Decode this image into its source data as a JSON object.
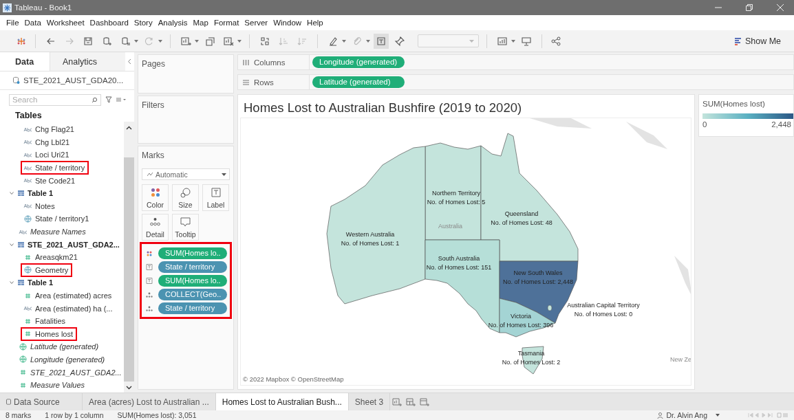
{
  "window": {
    "title": "Tableau - Book1"
  },
  "menu": [
    "File",
    "Data",
    "Worksheet",
    "Dashboard",
    "Story",
    "Analysis",
    "Map",
    "Format",
    "Server",
    "Window",
    "Help"
  ],
  "toolbar": {
    "show_me": "Show Me"
  },
  "data_pane": {
    "tabs": [
      {
        "label": "Data",
        "selected": true
      },
      {
        "label": "Analytics",
        "selected": false
      }
    ],
    "datasource": "STE_2021_AUST_GDA20...",
    "search": {
      "placeholder": "Search"
    },
    "tables_heading": "Tables",
    "partial_fields": [
      {
        "name": "Chg Flag21",
        "kind": "string",
        "italic": false,
        "highlighted": false
      },
      {
        "name": "Chg Lbl21",
        "kind": "string",
        "italic": false,
        "highlighted": false
      },
      {
        "name": "Loci Uri21",
        "kind": "string",
        "italic": false,
        "highlighted": false
      },
      {
        "name": "State / territory",
        "kind": "string",
        "italic": false,
        "highlighted": true
      },
      {
        "name": "Ste Code21",
        "kind": "string",
        "italic": false,
        "highlighted": false
      }
    ],
    "fields": [
      {
        "kind": "table",
        "name": "Table 1",
        "expanded": true,
        "children": [
          {
            "name": "Notes",
            "kind": "string",
            "italic": false,
            "highlighted": false
          },
          {
            "name": "State / territory1",
            "kind": "geo",
            "italic": false,
            "highlighted": false
          }
        ]
      },
      {
        "kind": "string",
        "name": "Measure Names",
        "italic": true,
        "highlighted": false
      },
      {
        "kind": "table",
        "name": "STE_2021_AUST_GDA2...",
        "expanded": true,
        "children": [
          {
            "name": "Areasqkm21",
            "kind": "number",
            "italic": false,
            "highlighted": false
          },
          {
            "name": "Geometry",
            "kind": "geo",
            "italic": false,
            "highlighted": true
          }
        ]
      },
      {
        "kind": "table",
        "name": "Table 1",
        "expanded": true,
        "children": [
          {
            "name": "Area (estimated) acres",
            "kind": "number",
            "italic": false,
            "highlighted": false
          },
          {
            "name": "Area (estimated) ha (...",
            "kind": "string",
            "italic": false,
            "highlighted": false
          },
          {
            "name": "Fatalities",
            "kind": "number",
            "italic": false,
            "highlighted": false
          },
          {
            "name": "Homes lost",
            "kind": "number",
            "italic": false,
            "highlighted": true
          }
        ]
      },
      {
        "kind": "generated",
        "name": "Latitude (generated)",
        "italic": true,
        "highlighted": false
      },
      {
        "kind": "generated",
        "name": "Longitude (generated)",
        "italic": true,
        "highlighted": false
      },
      {
        "kind": "number",
        "name": "STE_2021_AUST_GDA2...",
        "italic": true,
        "highlighted": false
      },
      {
        "kind": "number",
        "name": "Measure Values",
        "italic": true,
        "highlighted": false
      }
    ]
  },
  "pages": {
    "title": "Pages"
  },
  "filters": {
    "title": "Filters"
  },
  "marks": {
    "title": "Marks",
    "mark_type": "Automatic",
    "buttons": [
      {
        "label": "Color",
        "kind": "color"
      },
      {
        "label": "Size",
        "kind": "size"
      },
      {
        "label": "Label",
        "kind": "label"
      },
      {
        "label": "Detail",
        "kind": "detail"
      },
      {
        "label": "Tooltip",
        "kind": "tooltip"
      }
    ],
    "pills_highlighted": true,
    "pills": [
      {
        "label": "SUM(Homes lo..",
        "kind": "color",
        "color": "#1fae78"
      },
      {
        "label": "State / territory",
        "kind": "label",
        "color": "#4b93b1"
      },
      {
        "label": "SUM(Homes lo..",
        "kind": "label",
        "color": "#1fae78"
      },
      {
        "label": "COLLECT(Geo..",
        "kind": "detail",
        "color": "#4b93b1"
      },
      {
        "label": "State / territory",
        "kind": "detail",
        "color": "#4b93b1"
      }
    ]
  },
  "shelves": [
    {
      "label": "Columns",
      "kind": "columns",
      "pills": [
        {
          "label": "Longitude (generated)",
          "color": "#1fae78"
        }
      ]
    },
    {
      "label": "Rows",
      "kind": "rows",
      "pills": [
        {
          "label": "Latitude (generated)",
          "color": "#1fae78"
        }
      ]
    }
  ],
  "view": {
    "title": "Homes Lost to Australian Bushfire (2019 to 2020)",
    "regions": [
      {
        "name": "Northern Territory",
        "label": "No. of Homes Lost: 5",
        "color": "#c4e4dc"
      },
      {
        "name": "Queensland",
        "label": "No. of Homes Lost: 48",
        "color": "#c4e4dc"
      },
      {
        "name": "Western Australia",
        "label": "No. of Homes Lost: 1",
        "color": "#c4e4dc"
      },
      {
        "name": "South Australia",
        "label": "No. of Homes Lost: 151",
        "color": "#b6dfd8"
      },
      {
        "name": "New South Wales",
        "label": "No. of Homes Lost: 2,448",
        "color": "#4e7199"
      },
      {
        "name": "Australian Capital Territory",
        "label": "No. of Homes Lost: 0",
        "color": "#c4e4dc"
      },
      {
        "name": "Victoria",
        "label": "No. of Homes Lost: 396",
        "color": "#a4d4d4"
      },
      {
        "name": "Tasmania",
        "label": "No. of Homes Lost: 2",
        "color": "#c4e4dc"
      }
    ],
    "basemap_labels": [
      "Australia",
      "New Ze"
    ],
    "attribution": "© 2022 Mapbox © OpenStreetMap"
  },
  "legend": {
    "title": "SUM(Homes lost)",
    "min": "0",
    "max": "2,448"
  },
  "sheet_tabs": [
    {
      "label": "Data Source",
      "kind": "datasource",
      "selected": false
    },
    {
      "label": "Area (acres) Lost to Australian ...",
      "kind": "sheet",
      "selected": false
    },
    {
      "label": "Homes Lost to Australian Bush...",
      "kind": "sheet",
      "selected": true
    },
    {
      "label": "Sheet 3",
      "kind": "sheet",
      "selected": false
    }
  ],
  "status_bar": {
    "marks": "8 marks",
    "dimensions": "1 row by 1 column",
    "summary": "SUM(Homes lost): 3,051",
    "user": "Dr. Alvin Ang"
  }
}
